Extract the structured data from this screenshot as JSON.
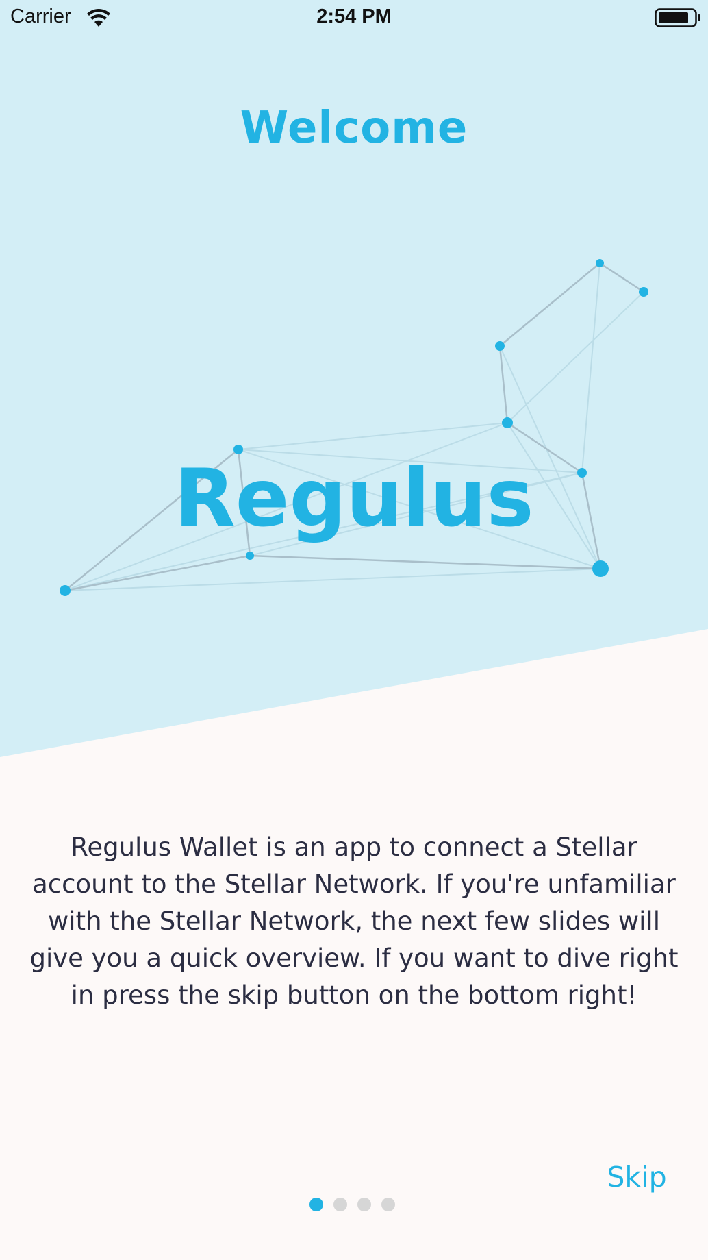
{
  "status_bar": {
    "carrier": "Carrier",
    "time": "2:54 PM"
  },
  "onboarding": {
    "title": "Welcome",
    "logo_text": "Regulus",
    "description": "Regulus Wallet is an app to connect a Stellar account to the Stellar Network. If you're unfamiliar with the Stellar Network, the next few slides will give you a quick overview. If you want to dive right in press the skip button on the bottom right!",
    "skip_label": "Skip",
    "page_count": 4,
    "current_page": 1
  },
  "colors": {
    "accent": "#22b3e3",
    "header_background": "#d3eef6",
    "body_background": "#fdf9f8",
    "text": "#2b2d42",
    "inactive_dot": "#d6d6d6"
  },
  "icons": [
    "wifi-icon",
    "battery-icon",
    "constellation-graphic"
  ]
}
